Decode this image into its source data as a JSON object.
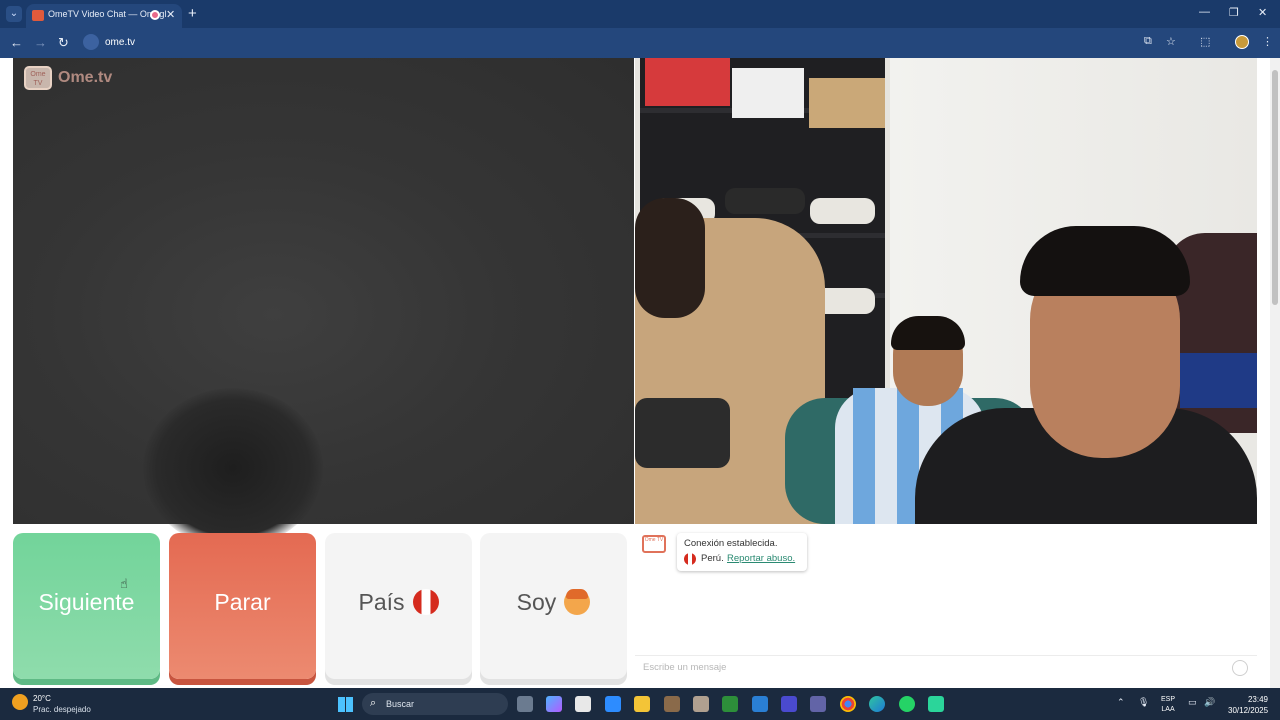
{
  "browser": {
    "tab_title": "OmeTV Video Chat — Omegle",
    "tab_close": "✕",
    "new_tab": "+",
    "url": "ome.tv",
    "window_controls": {
      "minimize": "—",
      "maximize": "❐",
      "close": "✕"
    }
  },
  "site": {
    "logo_text": "Ome.tv",
    "logo_badge": "Ome TV"
  },
  "controls": {
    "next_label": "Siguiente",
    "stop_label": "Parar",
    "country_label": "País",
    "country_flag": "peru-flag-icon",
    "gender_label": "Soy",
    "gender_icon": "boy-face-icon"
  },
  "chat": {
    "status": "Conexión establecida.",
    "country": "Perú.",
    "report_link": "Reportar abuso.",
    "placeholder": "Escribe un mensaje"
  },
  "taskbar": {
    "temperature": "20°C",
    "weather": "Prac. despejado",
    "search_label": "Buscar",
    "lang_line1": "ESP",
    "lang_line2": "LAA",
    "time": "23:49",
    "date": "30/12/2025"
  },
  "colors": {
    "next": "#7ed6a2",
    "stop": "#e8765c",
    "neutral": "#f4f4f4",
    "chrome": "#24477c"
  }
}
